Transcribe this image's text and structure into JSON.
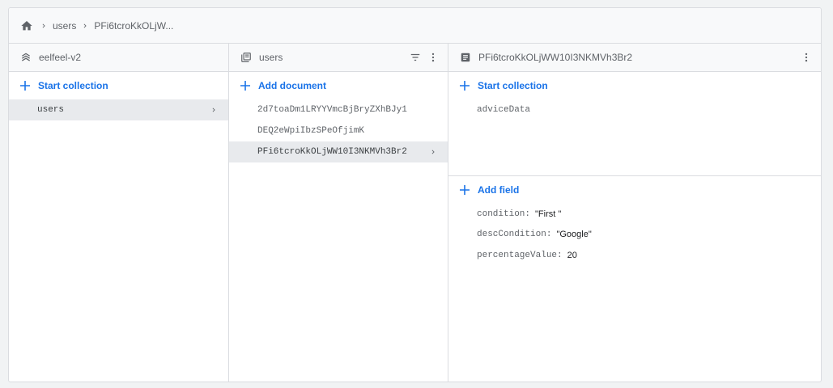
{
  "breadcrumb": {
    "home_icon": "home-icon",
    "items": [
      "users",
      "PFi6tcroKkOLjW..."
    ]
  },
  "colors": {
    "accent": "#1a73e8",
    "selected_bg": "#e8eaed",
    "border": "#dadce0",
    "header_bg": "#f8f9fa"
  },
  "col1": {
    "header_icon": "database-icon",
    "title": "eelfeel-v2",
    "action_label": "Start collection",
    "items": [
      {
        "label": "users",
        "selected": true
      }
    ]
  },
  "col2": {
    "header_icon": "collection-icon",
    "title": "users",
    "filter_icon": "filter-icon",
    "menu_icon": "more-vert-icon",
    "action_label": "Add document",
    "items": [
      {
        "label": "2d7toaDm1LRYYVmcBjBryZXhBJy1",
        "selected": false
      },
      {
        "label": "DEQ2eWpiIbzSPeOfjimK",
        "selected": false
      },
      {
        "label": "PFi6tcroKkOLjWW10I3NKMVh3Br2",
        "selected": true
      }
    ]
  },
  "col3": {
    "header_icon": "document-icon",
    "title": "PFi6tcroKkOLjWW10I3NKMVh3Br2",
    "menu_icon": "more-vert-icon",
    "collection_action_label": "Start collection",
    "subcollections": [
      "adviceData"
    ],
    "field_action_label": "Add field",
    "fields": [
      {
        "key": "condition",
        "value": "\"First \""
      },
      {
        "key": "descCondition",
        "value": "\"Google\""
      },
      {
        "key": "percentageValue",
        "value": "20"
      }
    ]
  }
}
